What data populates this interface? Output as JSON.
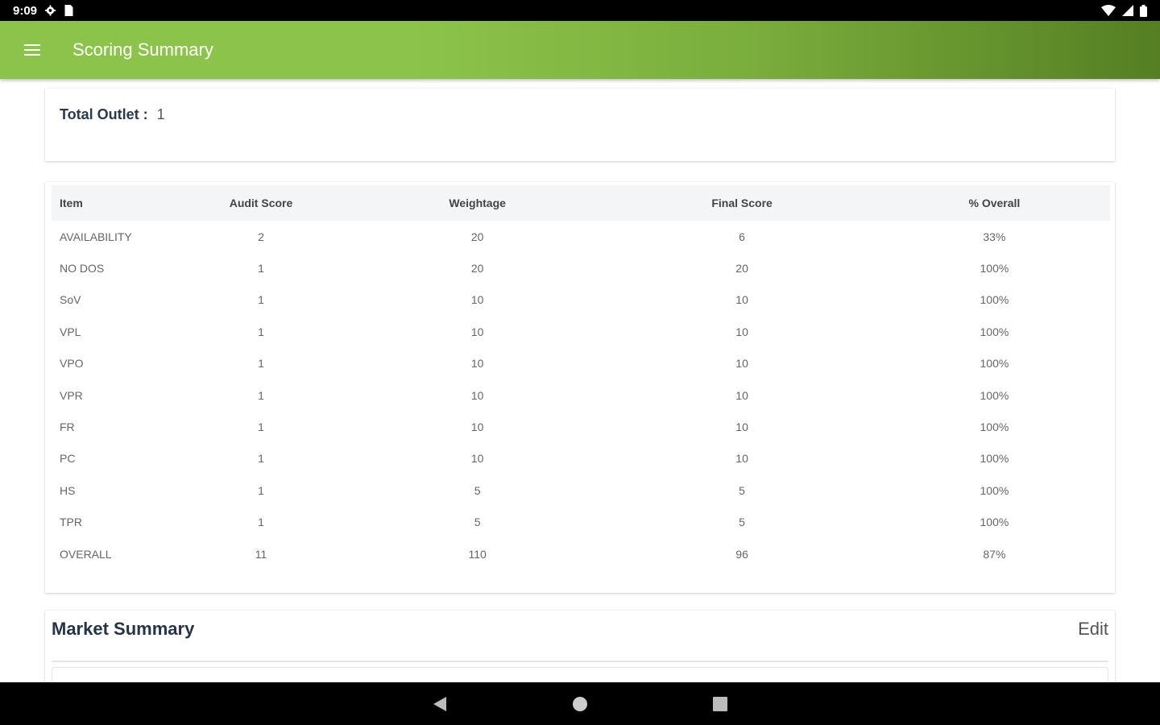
{
  "status_bar": {
    "time": "9:09",
    "icons_left": [
      "settings-icon",
      "sim-card-icon"
    ],
    "icons_right": [
      "wifi-icon",
      "signal-icon",
      "battery-icon"
    ]
  },
  "app_bar": {
    "title": "Scoring Summary",
    "menu_icon": "hamburger-menu-icon",
    "gradient_colors": [
      "#8cc44b",
      "#557f22"
    ]
  },
  "total_outlet": {
    "label": "Total Outlet :",
    "value": "1"
  },
  "score_table": {
    "headers": [
      "Item",
      "Audit Score",
      "Weightage",
      "Final Score",
      "% Overall"
    ],
    "rows": [
      [
        "AVAILABILITY",
        "2",
        "20",
        "6",
        "33%"
      ],
      [
        "NO DOS",
        "1",
        "20",
        "20",
        "100%"
      ],
      [
        "SoV",
        "1",
        "10",
        "10",
        "100%"
      ],
      [
        "VPL",
        "1",
        "10",
        "10",
        "100%"
      ],
      [
        "VPO",
        "1",
        "10",
        "10",
        "100%"
      ],
      [
        "VPR",
        "1",
        "10",
        "10",
        "100%"
      ],
      [
        "FR",
        "1",
        "10",
        "10",
        "100%"
      ],
      [
        "PC",
        "1",
        "10",
        "10",
        "100%"
      ],
      [
        "HS",
        "1",
        "5",
        "5",
        "100%"
      ],
      [
        "TPR",
        "1",
        "5",
        "5",
        "100%"
      ],
      [
        "OVERALL",
        "11",
        "110",
        "96",
        "87%"
      ]
    ]
  },
  "market_summary": {
    "title": "Market Summary",
    "edit_label": "Edit"
  },
  "nav_bar": {
    "buttons": [
      "back-icon",
      "home-icon",
      "recents-icon"
    ]
  }
}
